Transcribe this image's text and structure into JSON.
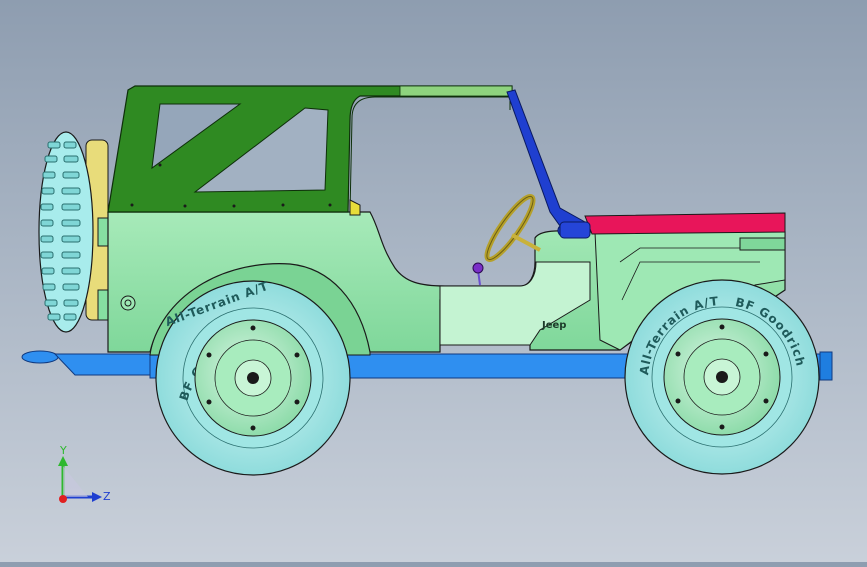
{
  "scene": {
    "model": "jeep-assembly",
    "colors": {
      "body": "#86dfa2",
      "body_light": "#b8f0c8",
      "roll_cage": "#2f8a22",
      "hood": "#e8155a",
      "chassis": "#2f8ff0",
      "tire": "#a8ecec",
      "windshield_frame": "#1f3fd0",
      "steering": "#c9b23a",
      "background_top": "#8e9db0",
      "background_bottom": "#c9d0da"
    }
  },
  "labels": {
    "badge": "Jeep",
    "rear_tire_brand": "BF Goodrich",
    "rear_tire_model": "All-Terrain A/T",
    "front_tire_brand": "BF Goodrich",
    "front_tire_model": "All-Terrain A/T"
  },
  "triad": {
    "y_label": "Y",
    "z_label": "Z"
  }
}
